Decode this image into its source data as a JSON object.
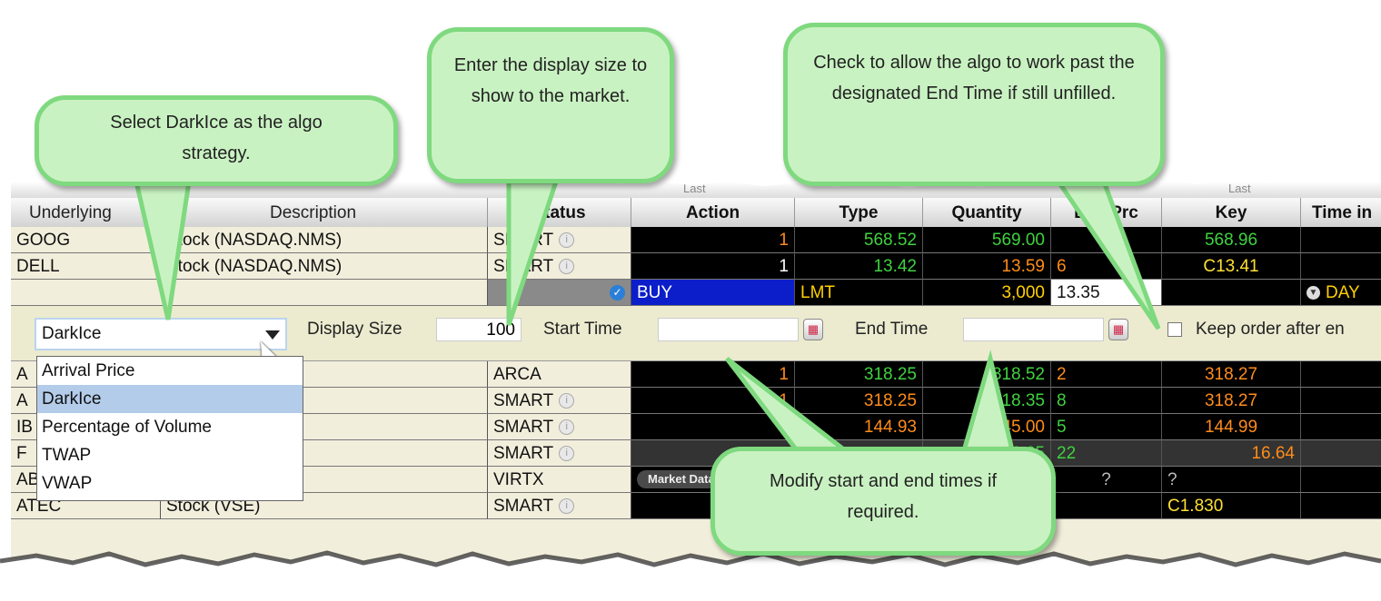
{
  "header_partial": [
    "Last",
    "Last"
  ],
  "columns": [
    "Underlying",
    "Description",
    "Status",
    "Action",
    "Type",
    "Quantity",
    "Lmt Prc",
    "Key",
    "Time in"
  ],
  "rows_top": [
    {
      "underlying": "GOOG",
      "description": "Stock (NASDAQ.NMS)",
      "status": "SMART",
      "c1": "1",
      "c2": "568.52",
      "c3": "569.00",
      "c4": "",
      "c5": "568.96"
    },
    {
      "underlying": "DELL",
      "description": "Stock (NASDAQ.NMS)",
      "status": "SMART",
      "c1": "1",
      "c2": "13.42",
      "c3": "13.59",
      "c4": "6",
      "c5": "C13.41"
    }
  ],
  "order_row": {
    "action": "BUY",
    "type": "LMT",
    "quantity": "3,000",
    "limit_price": "13.35",
    "tif": "DAY"
  },
  "algo_panel": {
    "strategy": "DarkIce",
    "display_size_label": "Display Size",
    "display_size_value": "100",
    "start_time_label": "Start Time",
    "start_time_value": "",
    "end_time_label": "End Time",
    "end_time_value": "",
    "keep_label": "Keep order after en"
  },
  "dropdown_options": [
    "Arrival Price",
    "DarkIce",
    "Percentage of Volume",
    "TWAP",
    "VWAP"
  ],
  "rows_bottom": [
    {
      "underlying": "A",
      "description": "AQ.NMS)",
      "status": "ARCA",
      "c1": "1",
      "c2": "318.25",
      "c3": "318.52",
      "c4": "2",
      "c5": "318.27"
    },
    {
      "underlying": "A",
      "description": "AQ.NMS)",
      "status": "SMART",
      "c1": "1",
      "c2": "318.25",
      "c3": "318.35",
      "c4": "8",
      "c5": "318.27"
    },
    {
      "underlying": "IB",
      "description": "",
      "status": "SMART",
      "c1": "1",
      "c2": "144.93",
      "c3": "145.00",
      "c4": "5",
      "c5": "144.99"
    },
    {
      "underlying": "F",
      "description": "",
      "status": "SMART",
      "c1": "",
      "c2": "",
      "c3": "16.65",
      "c4": "22",
      "c5": "16.64"
    },
    {
      "underlying": "ABBN",
      "description": "Stock (VIRTX)",
      "status": "VIRTX",
      "c1": "",
      "c2": "",
      "c3": "",
      "c4": "?",
      "c5": "?"
    },
    {
      "underlying": "ATEC",
      "description": "Stock (VSE)",
      "status": "SMART",
      "c1": "",
      "c2": "",
      "c3": "",
      "c4": "",
      "c5": "C1.830"
    }
  ],
  "market_data_label": "Market Data Subscri",
  "callouts": {
    "algo": "Select DarkIce as the algo strategy.",
    "display": "Enter the display size to show to the market.",
    "keep": "Check to allow the algo to work past the designated End Time if still unfilled.",
    "times": "Modify start and end times if required."
  }
}
